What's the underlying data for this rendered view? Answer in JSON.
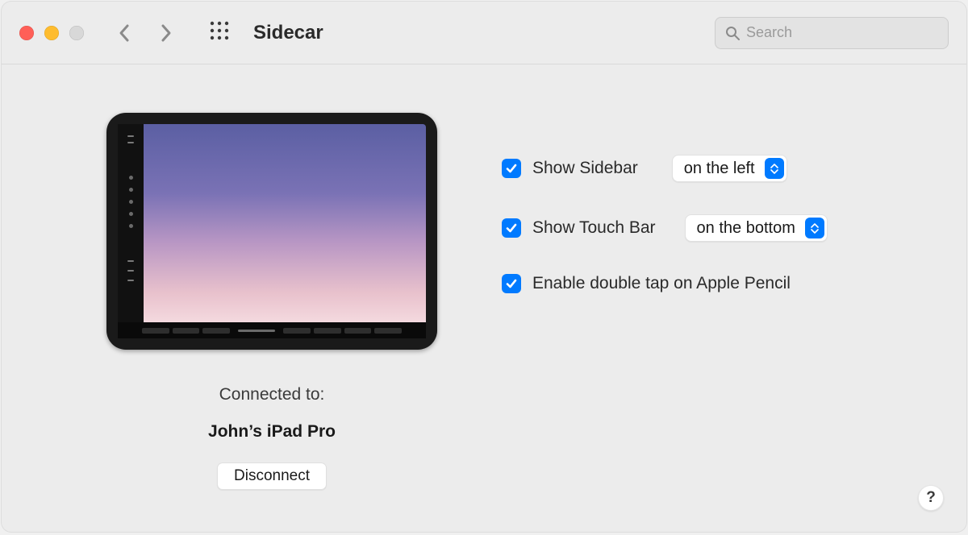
{
  "title": "Sidecar",
  "search": {
    "placeholder": "Search"
  },
  "connection": {
    "label": "Connected to:",
    "device": "John’s iPad Pro",
    "disconnect": "Disconnect"
  },
  "options": {
    "sidebar": {
      "checked": true,
      "label": "Show Sidebar",
      "value": "on the left"
    },
    "touchbar": {
      "checked": true,
      "label": "Show Touch Bar",
      "value": "on the bottom"
    },
    "pencil": {
      "checked": true,
      "label": "Enable double tap on Apple Pencil"
    }
  },
  "help": "?"
}
